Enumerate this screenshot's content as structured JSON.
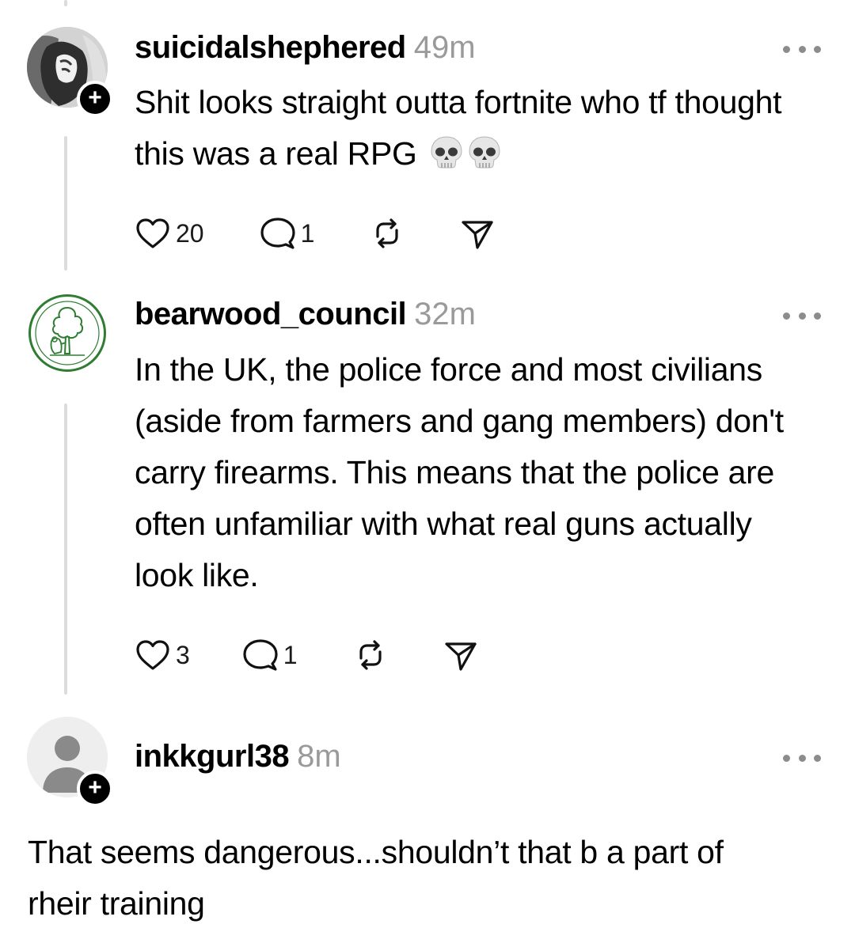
{
  "comments": [
    {
      "username": "suicidalshephered",
      "time": "49m",
      "text": "Shit looks straight outta fortnite who tf thought this was a real RPG",
      "emoji_icons": [
        "skull-emoji-icon",
        "skull-emoji-icon"
      ],
      "likes": "20",
      "replies": "1",
      "show_follow_badge": true
    },
    {
      "username": "bearwood_council",
      "time": "32m",
      "text": "In the UK, the police force and most civilians (aside from farmers and gang members) don't  carry firearms. This means that the police are often unfamiliar with what real guns actually look like.",
      "likes": "3",
      "replies": "1",
      "show_follow_badge": false
    },
    {
      "username": "inkkgurl38",
      "time": "8m",
      "text": "That seems dangerous...shouldn’t that b a part of rheir training",
      "show_follow_badge": true
    }
  ],
  "icons": {
    "follow": "+",
    "like": "heart-icon",
    "reply": "comment-icon",
    "repost": "repost-icon",
    "share": "send-icon",
    "more": "more-options-icon"
  },
  "colors": {
    "timestamp": "#9a9a9a",
    "thread_line": "#dcdcdc",
    "bearwood_logo": "#2e7d32"
  }
}
